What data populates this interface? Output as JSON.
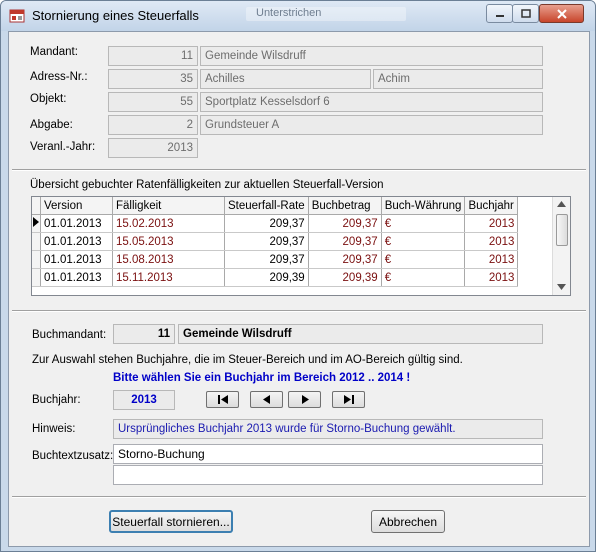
{
  "window": {
    "title": "Stornierung eines Steuerfalls",
    "ghost_text": "Unterstrichen"
  },
  "fields": {
    "mandant_label": "Mandant:",
    "mandant_nr": "11",
    "mandant_name": "Gemeinde Wilsdruff",
    "adress_label": "Adress-Nr.:",
    "adress_nr": "35",
    "adress_name1": "Achilles",
    "adress_name2": "Achim",
    "objekt_label": "Objekt:",
    "objekt_nr": "55",
    "objekt_name": "Sportplatz Kesselsdorf 6",
    "abgabe_label": "Abgabe:",
    "abgabe_nr": "2",
    "abgabe_name": "Grundsteuer A",
    "veranl_label": "Veranl.-Jahr:",
    "veranl_value": "2013"
  },
  "grid": {
    "heading": "Übersicht gebuchter Ratenfälligkeiten zur aktuellen Steuerfall-Version",
    "columns": [
      "Version",
      "Fälligkeit",
      "Steuerfall-Rate",
      "Buchbetrag",
      "Buch-Währung",
      "Buchjahr"
    ],
    "rows": [
      [
        "01.01.2013",
        "15.02.2013",
        "209,37",
        "209,37",
        "€",
        "2013"
      ],
      [
        "01.01.2013",
        "15.05.2013",
        "209,37",
        "209,37",
        "€",
        "2013"
      ],
      [
        "01.01.2013",
        "15.08.2013",
        "209,37",
        "209,37",
        "€",
        "2013"
      ],
      [
        "01.01.2013",
        "15.11.2013",
        "209,39",
        "209,39",
        "€",
        "2013"
      ]
    ]
  },
  "buchung": {
    "buchmandant_label": "Buchmandant:",
    "buchmandant_nr": "11",
    "buchmandant_name": "Gemeinde Wilsdruff",
    "info_text": "Zur Auswahl stehen Buchjahre, die im Steuer-Bereich und im AO-Bereich gültig sind.",
    "prompt_text": "Bitte wählen Sie ein Buchjahr im Bereich 2012 .. 2014 !",
    "buchjahr_label": "Buchjahr:",
    "buchjahr_value": "2013",
    "hinweis_label": "Hinweis:",
    "hinweis_text": "Ursprüngliches Buchjahr 2013 wurde für Storno-Buchung gewählt.",
    "buchtext_label": "Buchtextzusatz:",
    "buchtext_line1": "Storno-Buchung",
    "buchtext_line2": ""
  },
  "buttons": {
    "storno_label": "Steuerfall stornieren...",
    "cancel_label": "Abbrechen"
  },
  "colors": {
    "due_date_red": "#7a0f0f",
    "prompt_blue": "#0000c8",
    "hinweis_blue": "#1a1ab0"
  }
}
